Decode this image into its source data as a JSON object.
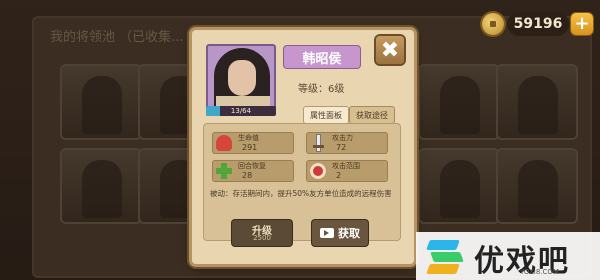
{
  "currency": {
    "amount": "59196",
    "add_symbol": "+"
  },
  "background": {
    "title": "我的将领池 （已收集..."
  },
  "hero": {
    "name": "韩昭侯",
    "level": "等级：6级",
    "exp": "13/64",
    "exp_progress": 0.2
  },
  "tabs": [
    {
      "label": "属性面板"
    },
    {
      "label": "获取途径"
    }
  ],
  "stats": [
    {
      "label": "生命值",
      "value": "291",
      "icon": "heart-icon"
    },
    {
      "label": "攻击力",
      "value": "72",
      "icon": "sword-icon"
    },
    {
      "label": "回合恢复",
      "value": "28",
      "icon": "plus-icon"
    },
    {
      "label": "攻击范围",
      "value": "2",
      "icon": "target-icon"
    }
  ],
  "passive": "被动：存活期间内，提升50%友方单位造成的远程伤害",
  "buttons": {
    "upgrade_label": "升级",
    "upgrade_cost": "2500",
    "get_label": "获取",
    "close_symbol": "✖"
  },
  "watermark": {
    "text": "优戏吧",
    "url": "YOXI8.COM"
  },
  "colors": {
    "name_badge": "#c796cf",
    "exp_fill": "#3fa7c9",
    "modal_bg": "#e9d6b0"
  }
}
